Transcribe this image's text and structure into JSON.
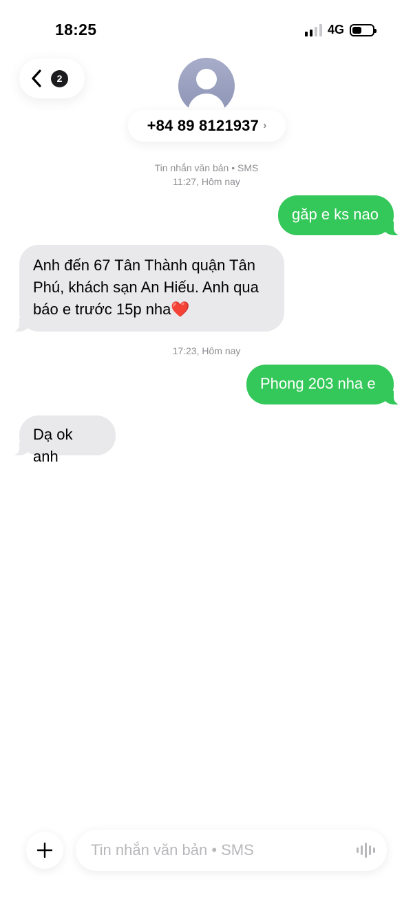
{
  "status_bar": {
    "time": "18:25",
    "network": "4G",
    "signal_bars_active": 2,
    "signal_bars_total": 4,
    "battery_level": 0.45
  },
  "header": {
    "unread_count": "2",
    "contact_name": "+84 89 8121937",
    "chevron": "›"
  },
  "conversation": {
    "service_label": "Tin nhắn văn bản • SMS",
    "time_label_1": "11:27, Hôm nay",
    "time_label_2": "17:23, Hôm nay",
    "messages": [
      {
        "direction": "out",
        "text": "găp e ks nao"
      },
      {
        "direction": "in",
        "text": "Anh đến 67 Tân Thành quận Tân Phú, khách sạn An Hiếu. Anh qua báo e trước 15p nha❤️"
      },
      {
        "direction": "out",
        "text": "Phong 203 nha e"
      },
      {
        "direction": "in",
        "text": "Dạ ok anh"
      }
    ]
  },
  "compose": {
    "placeholder": "Tin nhắn văn bản • SMS",
    "value": ""
  },
  "colors": {
    "outgoing_bubble": "#34c759",
    "incoming_bubble": "#e9e9eb",
    "meta_text": "#8e8e93"
  },
  "icons": {
    "back": "chevron-left-icon",
    "add": "plus-icon",
    "voice": "waveform-icon",
    "avatar": "person-icon"
  }
}
